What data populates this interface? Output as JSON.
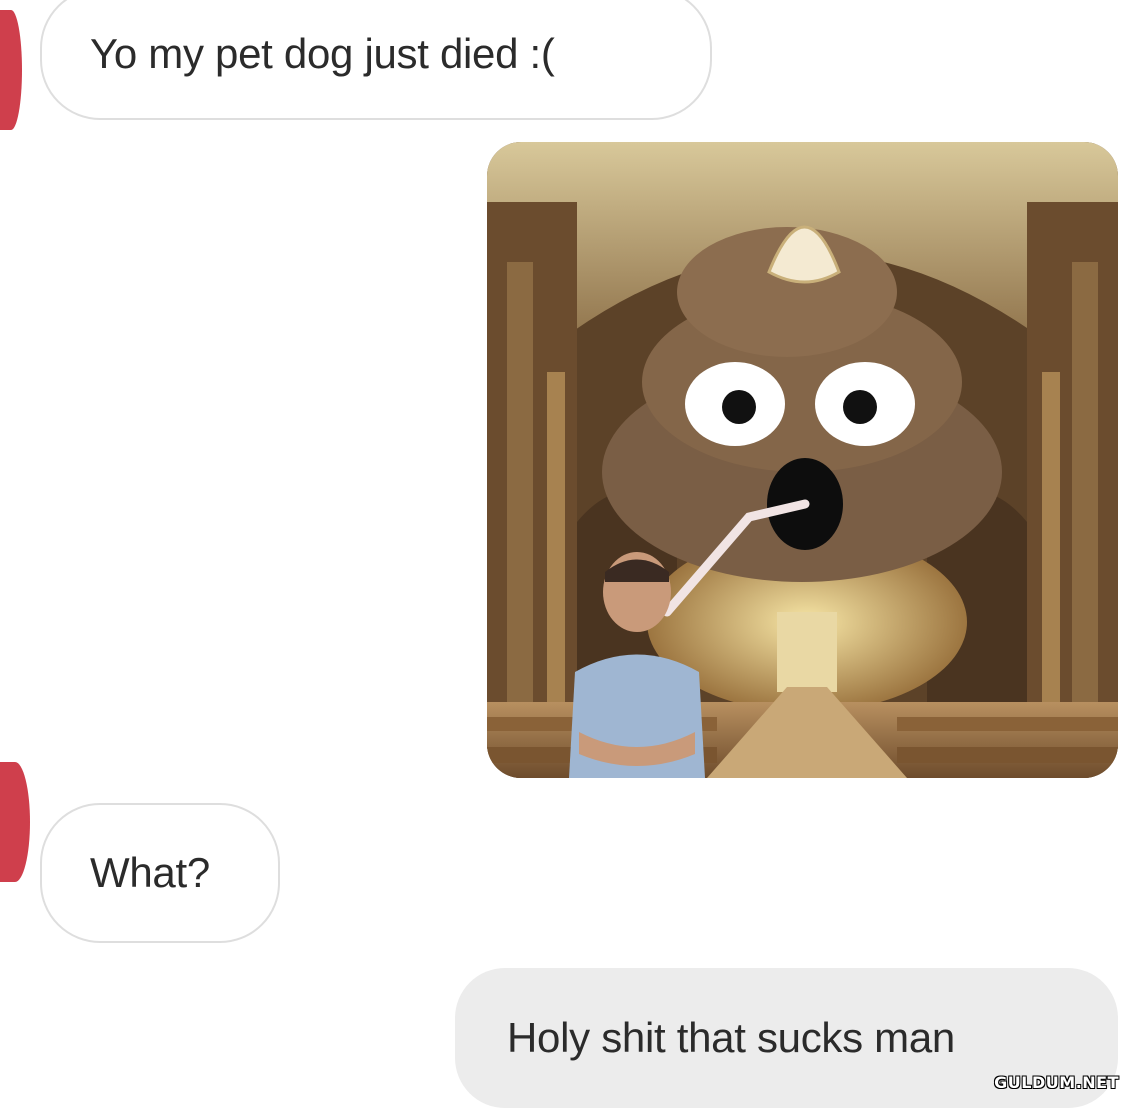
{
  "messages": [
    {
      "direction": "incoming",
      "text": "Yo my pet dog just died :("
    },
    {
      "direction": "outgoing",
      "type": "image",
      "image_label": "poop emoji in church with man"
    },
    {
      "direction": "incoming",
      "text": "What?"
    },
    {
      "direction": "outgoing",
      "text": "Holy shit that sucks man"
    }
  ],
  "watermark": "GULDUM.NET",
  "colors": {
    "incoming_bubble": "#ffffff",
    "incoming_border": "#dedede",
    "outgoing_bubble": "#ececec",
    "avatar_accent": "#cf3f4c",
    "text": "#2b2b2b"
  }
}
